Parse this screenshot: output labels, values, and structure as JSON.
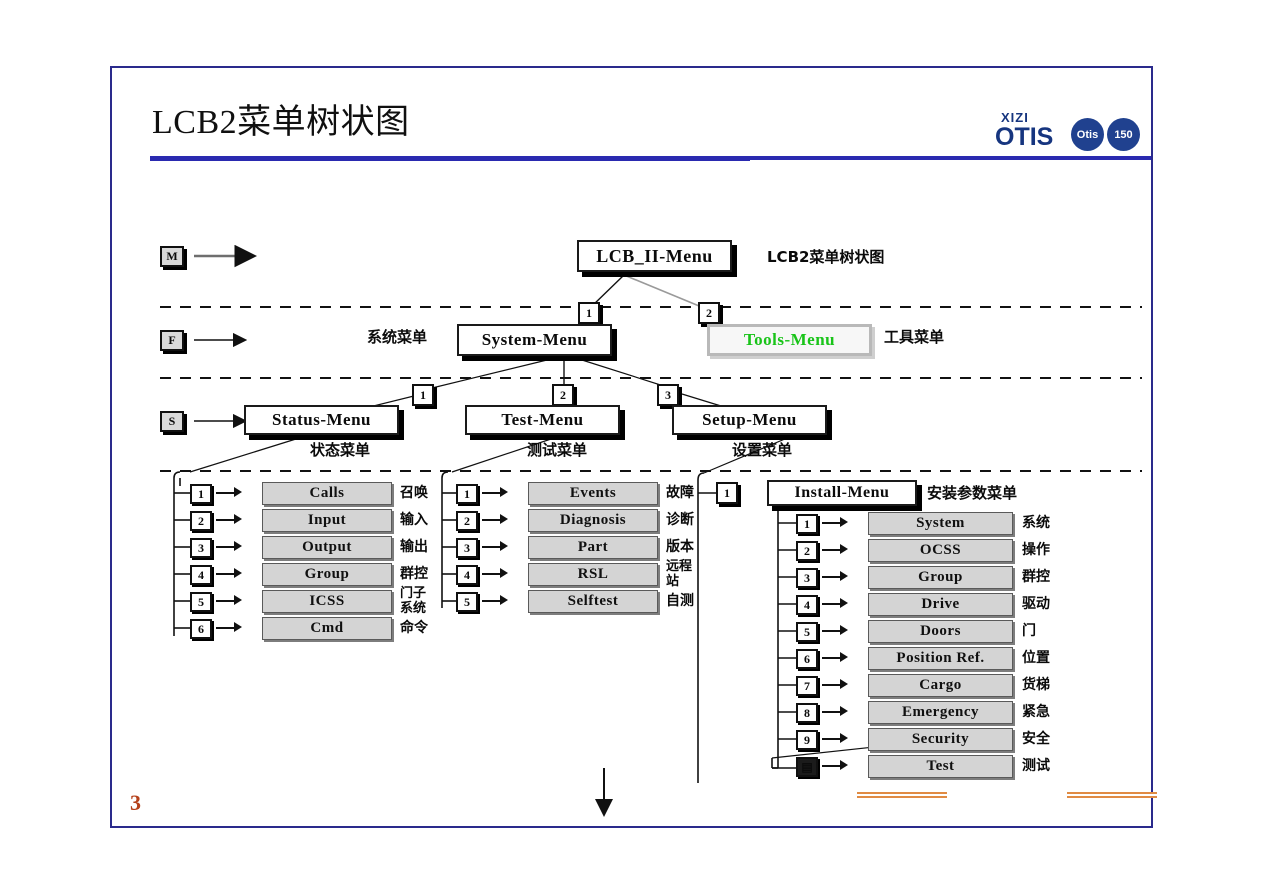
{
  "slide": {
    "title": "LCB2菜单树状图",
    "page_number": "3",
    "brand": {
      "top": "XIZI",
      "main": "OTIS",
      "badge1": "Otis",
      "badge2": "150"
    }
  },
  "diagram": {
    "caption": "LCB2菜单树状图",
    "keys": [
      {
        "id": "key-m",
        "label": "M"
      },
      {
        "id": "key-f",
        "label": "F"
      },
      {
        "id": "key-s",
        "label": "S"
      }
    ],
    "root": {
      "label": "LCB_II-Menu"
    },
    "level1": [
      {
        "num": "1",
        "label": "System-Menu",
        "cn": "系统菜单"
      },
      {
        "num": "2",
        "label": "Tools-Menu",
        "cn": "工具菜单"
      }
    ],
    "level2": [
      {
        "num": "1",
        "label": "Status-Menu",
        "cn": "状态菜单"
      },
      {
        "num": "2",
        "label": "Test-Menu",
        "cn": "测试菜单"
      },
      {
        "num": "3",
        "label": "Setup-Menu",
        "cn": "设置菜单"
      }
    ],
    "status_items": [
      {
        "num": "1",
        "label": "Calls",
        "cn": "召唤"
      },
      {
        "num": "2",
        "label": "Input",
        "cn": "输入"
      },
      {
        "num": "3",
        "label": "Output",
        "cn": "输出"
      },
      {
        "num": "4",
        "label": "Group",
        "cn": "群控"
      },
      {
        "num": "5",
        "label": "ICSS",
        "cn": "门子系统"
      },
      {
        "num": "6",
        "label": "Cmd",
        "cn": "命令"
      }
    ],
    "test_items": [
      {
        "num": "1",
        "label": "Events",
        "cn": "故障"
      },
      {
        "num": "2",
        "label": "Diagnosis",
        "cn": "诊断"
      },
      {
        "num": "3",
        "label": "Part",
        "cn": "版本"
      },
      {
        "num": "4",
        "label": "RSL",
        "cn": "远程站"
      },
      {
        "num": "5",
        "label": "Selftest",
        "cn": "自测"
      }
    ],
    "install": {
      "num": "1",
      "label": "Install-Menu",
      "cn": "安装参数菜单"
    },
    "install_items": [
      {
        "num": "1",
        "label": "System",
        "cn": "系统"
      },
      {
        "num": "2",
        "label": "OCSS",
        "cn": "操作"
      },
      {
        "num": "3",
        "label": "Group",
        "cn": "群控"
      },
      {
        "num": "4",
        "label": "Drive",
        "cn": "驱动"
      },
      {
        "num": "5",
        "label": "Doors",
        "cn": "门"
      },
      {
        "num": "6",
        "label": "Position Ref.",
        "cn": "位置"
      },
      {
        "num": "7",
        "label": "Cargo",
        "cn": "货梯"
      },
      {
        "num": "8",
        "label": "Emergency",
        "cn": "紧急"
      },
      {
        "num": "9",
        "label": "Security",
        "cn": "安全"
      },
      {
        "num": "▤",
        "label": "Test",
        "cn": "测试"
      }
    ]
  },
  "colors": {
    "frame": "#2a2a8c",
    "rule": "#2a2ab0",
    "page_number": "#b5411b",
    "tools_text": "#19c419",
    "leaf_fill": "#d4d4d4",
    "deco": "#e08b43",
    "brand": "#16357f"
  }
}
